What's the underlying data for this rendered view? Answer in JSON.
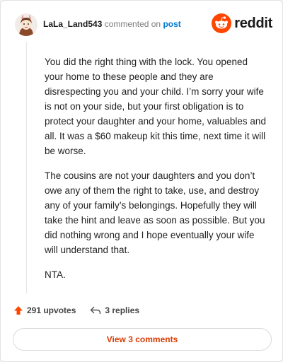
{
  "header": {
    "username": "LaLa_Land543",
    "commented_on": "commented on",
    "post_link": "post",
    "brand": "reddit"
  },
  "comment": {
    "paragraphs": [
      "You did the right thing with the lock. You opened your home to these people and they are disrespecting you and your child. I’m sorry your wife is not on your side, but your first obligation is to protect your daughter and your home, valuables and all. It was a $60 makeup kit this time, next time it will be worse.",
      "The cousins are not your daughters and you don’t owe any of them the right to take, use, and destroy any of your family’s belongings. Hopefully they will take the hint and leave as soon as possible. But you did nothing wrong and I hope eventually your wife will understand that.",
      "NTA."
    ]
  },
  "actions": {
    "upvotes": "291 upvotes",
    "replies": "3 replies"
  },
  "view_button": "View 3 comments",
  "colors": {
    "brand_orange": "#ff4500",
    "link_blue": "#0079d3",
    "button_text": "#d93a00"
  },
  "icons": [
    "avatar",
    "reddit-logo-icon",
    "upvote-arrow-icon",
    "reply-arrow-icon"
  ]
}
